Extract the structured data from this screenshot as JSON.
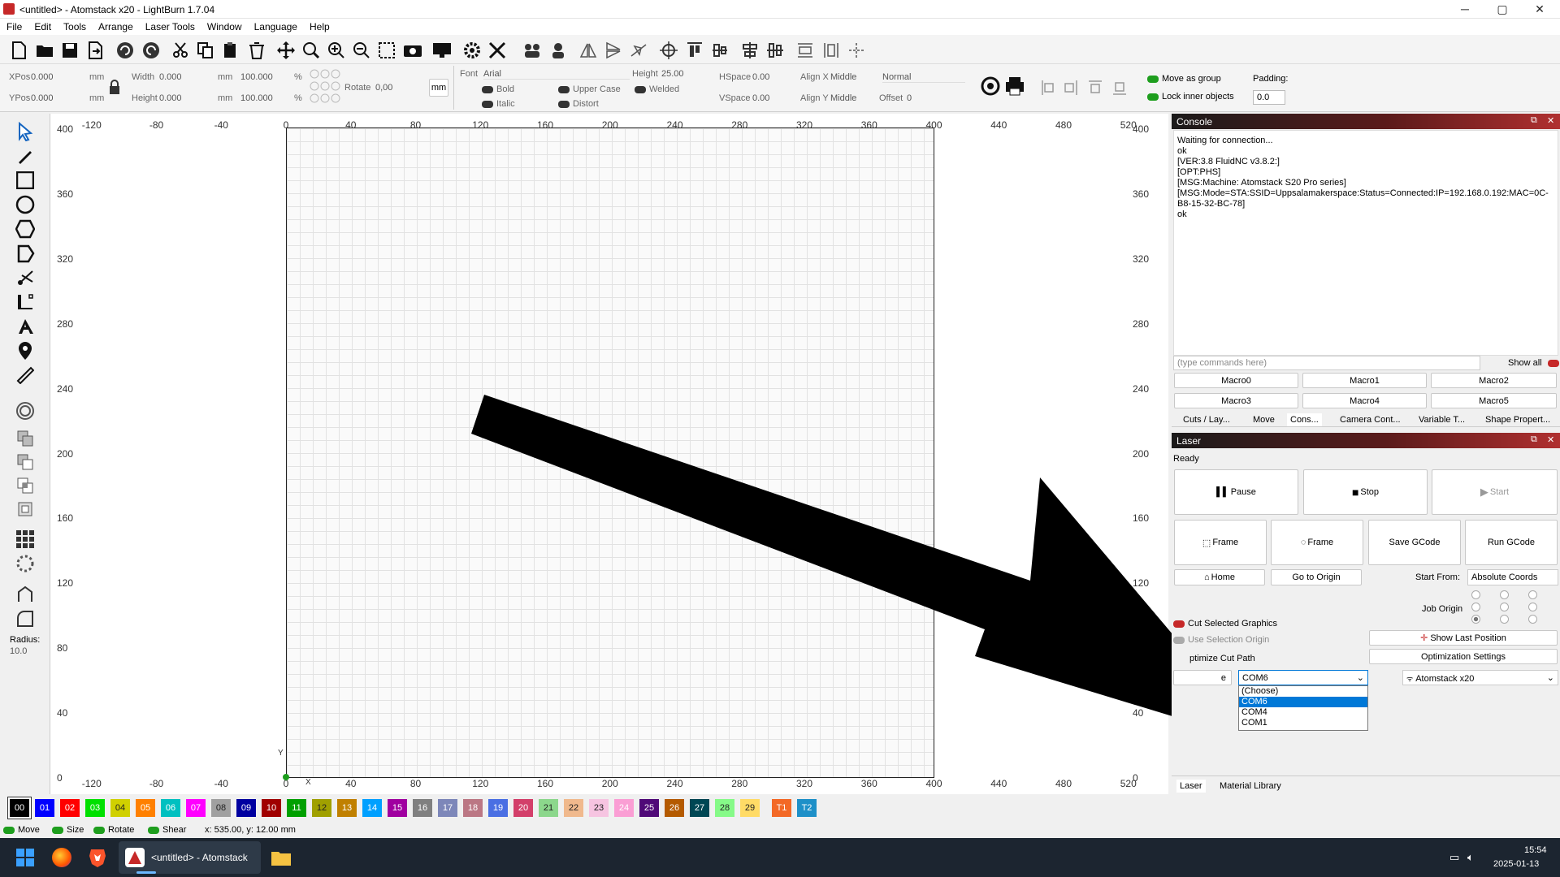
{
  "window": {
    "title": "<untitled> - Atomstack x20 - LightBurn 1.7.04",
    "min": "─",
    "max": "▢",
    "close": "✕"
  },
  "menu": [
    "File",
    "Edit",
    "Tools",
    "Arrange",
    "Laser Tools",
    "Window",
    "Language",
    "Help"
  ],
  "props": {
    "xpos_label": "XPos",
    "xpos": "0.000",
    "ypos_label": "YPos",
    "ypos": "0.000",
    "unit": "mm",
    "width_label": "Width",
    "width": "0.000",
    "height_label": "Height",
    "height": "0.000",
    "pct1": "100.000",
    "pct2": "100.000",
    "pct": "%",
    "rotate_label": "Rotate",
    "rotate": "0,00",
    "mm_btn": "mm",
    "font_label": "Font",
    "font": "Arial",
    "fheight_label": "Height",
    "fheight": "25.00",
    "hspace_label": "HSpace",
    "hspace": "0.00",
    "vspace_label": "VSpace",
    "vspace": "0.00",
    "alignx_label": "Align X",
    "alignx": "Middle",
    "aligny_label": "Align Y",
    "aligny": "Middle",
    "normal": "Normal",
    "offset_label": "Offset",
    "offset": "0",
    "bold": "Bold",
    "italic": "Italic",
    "upper": "Upper Case",
    "distort": "Distort",
    "welded": "Welded",
    "move_group": "Move as group",
    "lock_inner": "Lock inner objects",
    "padding_label": "Padding:",
    "padding": "0.0"
  },
  "ruler": {
    "x": [
      "-120",
      "-80",
      "-40",
      "0",
      "40",
      "80",
      "120",
      "160",
      "200",
      "240",
      "280",
      "320",
      "360",
      "400",
      "440",
      "480",
      "520"
    ],
    "y": [
      "400",
      "360",
      "320",
      "280",
      "240",
      "200",
      "160",
      "120",
      "80",
      "40",
      "0"
    ],
    "y_axis": "Y",
    "x_axis": "X"
  },
  "left_tools": {
    "radius_label": "Radius:",
    "radius": "10.0"
  },
  "console": {
    "title": "Console",
    "output": "Waiting for connection...\nok\n[VER:3.8 FluidNC v3.8.2:]\n[OPT:PHS]\n[MSG:Machine: Atomstack S20 Pro series]\n[MSG:Mode=STA:SSID=Uppsalamakerspace:Status=Connected:IP=192.168.0.192:MAC=0C-B8-15-32-BC-78]\nok",
    "placeholder": "(type commands here)",
    "show_all": "Show all",
    "macros": [
      "Macro0",
      "Macro1",
      "Macro2",
      "Macro3",
      "Macro4",
      "Macro5"
    ],
    "tabs": [
      "Cuts / Lay...",
      "Move",
      "Cons...",
      "Camera Cont...",
      "Variable T...",
      "Shape Propert..."
    ]
  },
  "laser": {
    "title": "Laser",
    "status": "Ready",
    "pause": "Pause",
    "stop": "Stop",
    "start": "Start",
    "frame1": "Frame",
    "frame2": "Frame",
    "save_gcode": "Save GCode",
    "run_gcode": "Run GCode",
    "home": "Home",
    "go_origin": "Go to Origin",
    "start_from_label": "Start From:",
    "start_from": "Absolute Coords",
    "job_origin": "Job Origin",
    "cut_selected": "Cut Selected Graphics",
    "use_selection_origin": "Use Selection Origin",
    "optimize_cut_path": "ptimize Cut Path",
    "show_last_position": "Show Last Position",
    "optimization_settings": "Optimization Settings",
    "devices_partial": "e",
    "port": "COM6",
    "port_options": [
      "(Choose)",
      "COM6",
      "COM4",
      "COM1"
    ],
    "device": "Atomstack x20",
    "bottom_tabs": [
      "Laser",
      "Material Library"
    ]
  },
  "layers": [
    {
      "label": "00",
      "color": "#000000"
    },
    {
      "label": "01",
      "color": "#0000ff"
    },
    {
      "label": "02",
      "color": "#ff0000"
    },
    {
      "label": "03",
      "color": "#00e000"
    },
    {
      "label": "04",
      "color": "#d0d000"
    },
    {
      "label": "05",
      "color": "#ff8000"
    },
    {
      "label": "06",
      "color": "#00c0c0"
    },
    {
      "label": "07",
      "color": "#ff00ff"
    },
    {
      "label": "08",
      "color": "#a0a0a0"
    },
    {
      "label": "09",
      "color": "#0000a0"
    },
    {
      "label": "10",
      "color": "#a00000"
    },
    {
      "label": "11",
      "color": "#00a000"
    },
    {
      "label": "12",
      "color": "#a0a000"
    },
    {
      "label": "13",
      "color": "#c08000"
    },
    {
      "label": "14",
      "color": "#00a0ff"
    },
    {
      "label": "15",
      "color": "#a000a0"
    },
    {
      "label": "16",
      "color": "#808080"
    },
    {
      "label": "17",
      "color": "#7d87b9"
    },
    {
      "label": "18",
      "color": "#bb7784"
    },
    {
      "label": "19",
      "color": "#4a6fe3"
    },
    {
      "label": "20",
      "color": "#d33f6a"
    },
    {
      "label": "21",
      "color": "#8cd78c"
    },
    {
      "label": "22",
      "color": "#f0b98d"
    },
    {
      "label": "23",
      "color": "#f6c4e1"
    },
    {
      "label": "24",
      "color": "#fa9ed4"
    },
    {
      "label": "25",
      "color": "#500a78"
    },
    {
      "label": "26",
      "color": "#b45a00"
    },
    {
      "label": "27",
      "color": "#004754"
    },
    {
      "label": "28",
      "color": "#86fa88"
    },
    {
      "label": "29",
      "color": "#ffdb66"
    },
    {
      "label": "T1",
      "color": "#f36926"
    },
    {
      "label": "T2",
      "color": "#1e90c8"
    }
  ],
  "status": {
    "move": "Move",
    "size": "Size",
    "rotate": "Rotate",
    "shear": "Shear",
    "coords": "x: 535.00, y: 12.00 mm"
  },
  "taskbar": {
    "app": "<untitled> - Atomstack",
    "time": "15:54",
    "date": "2025-01-13"
  }
}
